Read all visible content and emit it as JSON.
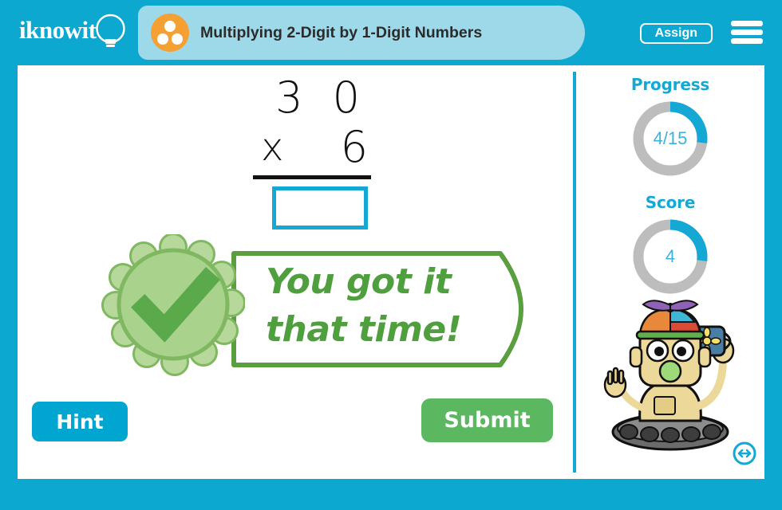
{
  "header": {
    "logo_text": "iknowit",
    "logo_icon": "lightbulb-icon",
    "lesson_title": "Multiplying 2-Digit by 1-Digit Numbers",
    "lesson_icon": "three-dots-circle-icon",
    "assign_label": "Assign",
    "menu_icon": "hamburger-menu-icon",
    "bar_color": "#0da8d0",
    "title_pill_color": "#9ed9ea",
    "lesson_icon_color": "#f5a033"
  },
  "question": {
    "operand1": "3 0",
    "operator": "x",
    "operand2": "6",
    "answer_value": "",
    "answer_placeholder": "",
    "input_border_color": "#16a8d4"
  },
  "feedback": {
    "message_line1": "You got it",
    "message_line2": "that time!",
    "badge_icon": "check-rosette-icon",
    "color": "#4f9f3f",
    "badge_fill": "#a8d08d",
    "badge_ring": "#6aab4e"
  },
  "actions": {
    "hint_label": "Hint",
    "hint_color": "#00a5d0",
    "submit_label": "Submit",
    "submit_color": "#5cb860"
  },
  "sidebar": {
    "progress": {
      "label": "Progress",
      "value": "4/15",
      "completed": 4,
      "total": 15,
      "percent": 27,
      "arc_color": "#16a8d4",
      "track_color": "#bdbdbd"
    },
    "score": {
      "label": "Score",
      "value": "4",
      "percent": 27,
      "arc_color": "#16a8d4",
      "track_color": "#bdbdbd"
    },
    "mascot_icon": "robot-mascot-with-watering-can",
    "resize_icon": "horizontal-resize-arrows-icon"
  }
}
